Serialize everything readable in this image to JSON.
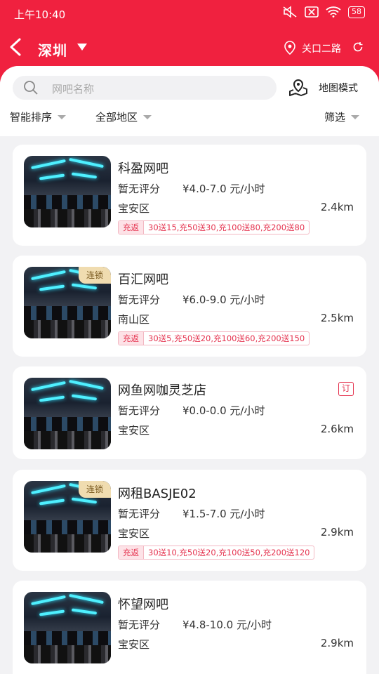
{
  "status_bar": {
    "time": "上午10:40",
    "battery": "58"
  },
  "nav": {
    "city": "深圳",
    "location": "关口二路"
  },
  "search": {
    "placeholder": "网吧名称",
    "map_mode": "地图模式"
  },
  "filters": {
    "sort": "智能排序",
    "area": "全部地区",
    "filter": "筛选"
  },
  "cafes": [
    {
      "name": "科盈网吧",
      "rating": "暂无评分",
      "price": "¥4.0-7.0 元/小时",
      "district": "宝安区",
      "distance": "2.4km",
      "chain": "",
      "booking": "",
      "promo_tag": "充返",
      "promo": "30送15,充50送30,充100送80,充200送80"
    },
    {
      "name": "百汇网吧",
      "rating": "暂无评分",
      "price": "¥6.0-9.0 元/小时",
      "district": "南山区",
      "distance": "2.5km",
      "chain": "连锁",
      "booking": "",
      "promo_tag": "充返",
      "promo": "30送5,充50送20,充100送60,充200送150"
    },
    {
      "name": "网鱼网咖灵芝店",
      "rating": "暂无评分",
      "price": "¥0.0-0.0 元/小时",
      "district": "宝安区",
      "distance": "2.6km",
      "chain": "",
      "booking": "订",
      "promo_tag": "",
      "promo": ""
    },
    {
      "name": "网租BASJE02",
      "rating": "暂无评分",
      "price": "¥1.5-7.0 元/小时",
      "district": "宝安区",
      "distance": "2.9km",
      "chain": "连锁",
      "booking": "",
      "promo_tag": "充返",
      "promo": "30送10,充50送20,充100送50,充200送120"
    },
    {
      "name": "怀望网吧",
      "rating": "暂无评分",
      "price": "¥4.8-10.0 元/小时",
      "district": "宝安区",
      "distance": "2.9km",
      "chain": "",
      "booking": "",
      "promo_tag": "",
      "promo": ""
    }
  ],
  "colors": {
    "brand": "#f0213f",
    "promo": "#e5334f",
    "chain_bg": "#f0dcb0"
  }
}
